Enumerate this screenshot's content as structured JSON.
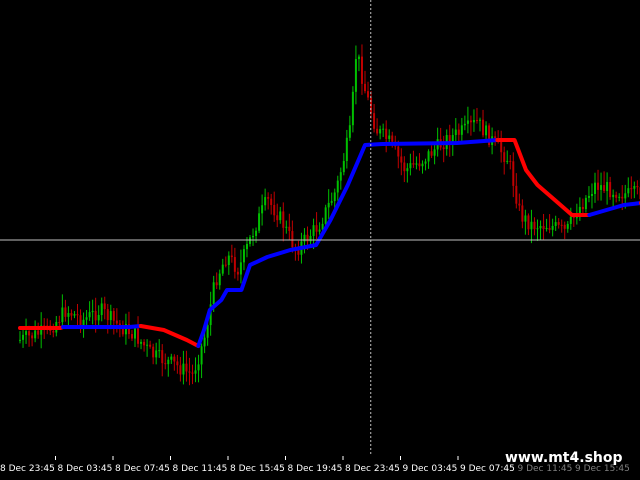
{
  "watermark": "www.mt4.shop",
  "chart_data": {
    "type": "candlestick",
    "xlabel": "",
    "ylabel": "",
    "grid": false,
    "colors": {
      "background": "#000000",
      "bull_candle": "#00c000",
      "bear_candle": "#c00000",
      "indicator_up": "#0000ff",
      "indicator_down": "#ff0000",
      "crosshair": "#c0c0c0",
      "axis_text": "#ffffff"
    },
    "x_tick_labels": [
      {
        "label": "8 Dec 23:45",
        "faded": false
      },
      {
        "label": "8 Dec 03:45",
        "faded": false
      },
      {
        "label": "8 Dec 07:45",
        "faded": false
      },
      {
        "label": "8 Dec 11:45",
        "faded": false
      },
      {
        "label": "8 Dec 15:45",
        "faded": false
      },
      {
        "label": "8 Dec 19:45",
        "faded": false
      },
      {
        "label": "8 Dec 23:45",
        "faded": false
      },
      {
        "label": "9 Dec 03:45",
        "faded": false
      },
      {
        "label": "9 Dec 07:45",
        "faded": false
      },
      {
        "label": "9 Dec 11:45",
        "faded": true
      },
      {
        "label": "9 Dec 15:45",
        "faded": true
      }
    ],
    "crosshair": {
      "x_index": 6.1,
      "y_value": 240
    },
    "indicator_line": {
      "name": "",
      "segments": [
        {
          "trend": "down",
          "points": [
            [
              0,
              328
            ],
            [
              0.7,
              328
            ],
            [
              0.75,
              327
            ]
          ]
        },
        {
          "trend": "up",
          "points": [
            [
              0.75,
              327
            ],
            [
              1.9,
              327
            ],
            [
              2.1,
              326
            ]
          ]
        },
        {
          "trend": "down",
          "points": [
            [
              2.1,
              326
            ],
            [
              2.5,
              330
            ],
            [
              2.9,
              340
            ],
            [
              3.1,
              346
            ]
          ]
        },
        {
          "trend": "up",
          "points": [
            [
              3.1,
              346
            ],
            [
              3.2,
              330
            ],
            [
              3.3,
              310
            ],
            [
              3.5,
              300
            ],
            [
              3.6,
              290
            ],
            [
              3.85,
              290
            ],
            [
              4.0,
              265
            ],
            [
              4.3,
              257
            ],
            [
              4.7,
              250
            ],
            [
              5.15,
              245
            ],
            [
              5.4,
              220
            ],
            [
              5.7,
              185
            ],
            [
              6.0,
              145
            ],
            [
              6.3,
              144
            ],
            [
              7.6,
              143
            ],
            [
              8.3,
              140
            ]
          ]
        },
        {
          "trend": "down",
          "points": [
            [
              8.3,
              140
            ],
            [
              8.6,
              140
            ],
            [
              8.8,
              170
            ],
            [
              9.0,
              185
            ],
            [
              9.3,
              200
            ],
            [
              9.6,
              215
            ],
            [
              9.9,
              215
            ]
          ]
        },
        {
          "trend": "up",
          "points": [
            [
              9.9,
              215
            ],
            [
              10.2,
              210
            ],
            [
              10.5,
              205
            ],
            [
              10.8,
              203
            ],
            [
              11.15,
              205
            ]
          ]
        },
        {
          "trend": "down",
          "points": [
            [
              10.8,
              203
            ],
            [
              11.15,
              205
            ]
          ]
        }
      ]
    },
    "candles": {
      "path": [
        [
          0,
          340
        ],
        [
          0.5,
          330
        ],
        [
          0.8,
          310
        ],
        [
          1.1,
          320
        ],
        [
          1.4,
          310
        ],
        [
          1.7,
          325
        ],
        [
          2.0,
          335
        ],
        [
          2.3,
          355
        ],
        [
          2.7,
          365
        ],
        [
          3.0,
          375
        ],
        [
          3.2,
          340
        ],
        [
          3.4,
          280
        ],
        [
          3.6,
          255
        ],
        [
          3.8,
          270
        ],
        [
          4.1,
          225
        ],
        [
          4.3,
          200
        ],
        [
          4.5,
          215
        ],
        [
          4.8,
          250
        ],
        [
          5.2,
          225
        ],
        [
          5.5,
          190
        ],
        [
          5.75,
          130
        ],
        [
          5.85,
          50
        ],
        [
          6.0,
          90
        ],
        [
          6.2,
          130
        ],
        [
          6.4,
          140
        ],
        [
          6.7,
          170
        ],
        [
          7.0,
          160
        ],
        [
          7.4,
          140
        ],
        [
          7.75,
          130
        ],
        [
          7.95,
          122
        ],
        [
          8.2,
          140
        ],
        [
          8.5,
          160
        ],
        [
          8.7,
          215
        ],
        [
          8.9,
          225
        ],
        [
          9.2,
          225
        ],
        [
          9.5,
          232
        ],
        [
          9.7,
          210
        ],
        [
          10.0,
          185
        ],
        [
          10.3,
          190
        ],
        [
          10.6,
          195
        ],
        [
          11.0,
          190
        ]
      ],
      "count": 210
    }
  }
}
